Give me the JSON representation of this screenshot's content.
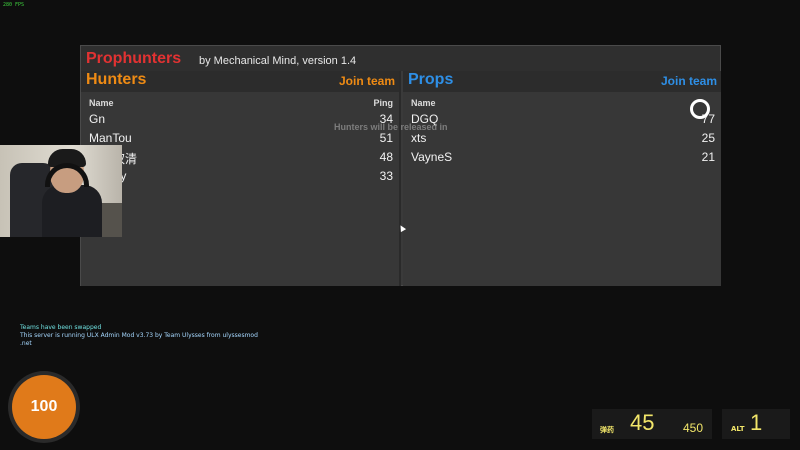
{
  "fps": "280 FPS",
  "panel": {
    "title": "Prophunters",
    "subtitle": "by Mechanical Mind, version 1.4",
    "countdown": "Hunters will be released in"
  },
  "hunters": {
    "team_name": "Hunters",
    "join_label": "Join team",
    "col_name": "Name",
    "col_ping": "Ping",
    "players": [
      {
        "name": "Gn",
        "ping": "34"
      },
      {
        "name": "ManTou",
        "ping": "51"
      },
      {
        "name": "雪吴权清",
        "ping": "48"
      },
      {
        "name": "utvdiyy",
        "ping": "33"
      }
    ]
  },
  "props": {
    "team_name": "Props",
    "join_label": "Join team",
    "col_name": "Name",
    "players": [
      {
        "name": "DGQ",
        "ping": "77"
      },
      {
        "name": "xts",
        "ping": "25"
      },
      {
        "name": "VayneS",
        "ping": "21"
      }
    ]
  },
  "chat": {
    "line1": "Teams have been swapped",
    "line2": "This server is running ULX Admin Mod v3.73 by Team Ulysses from ulyssesmod",
    "line3": ".net"
  },
  "hud": {
    "health": "100",
    "ammo_label": "弹药",
    "ammo_clip": "45",
    "ammo_reserve": "450",
    "alt_label": "ALT",
    "alt_value": "1"
  }
}
